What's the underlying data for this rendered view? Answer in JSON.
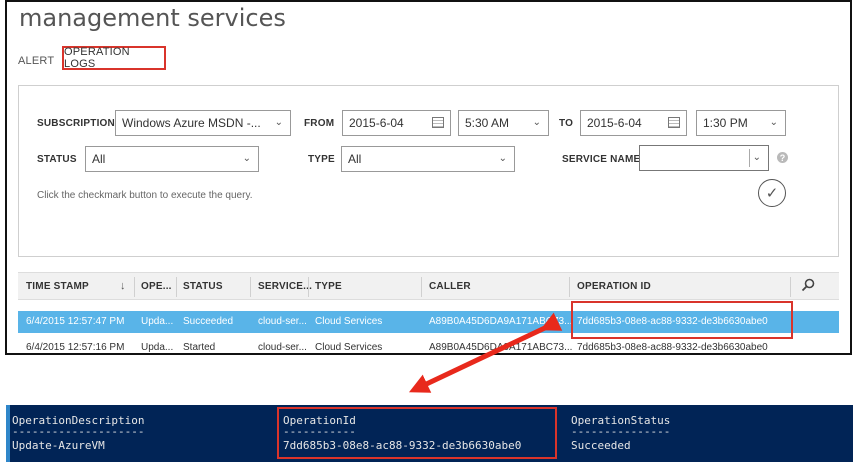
{
  "page": {
    "title": "management services"
  },
  "tabs": [
    {
      "label": "ALERT"
    },
    {
      "label": "OPERATION LOGS"
    }
  ],
  "filters": {
    "subscription": {
      "label": "SUBSCRIPTION",
      "value": "Windows Azure MSDN -..."
    },
    "from": {
      "label": "FROM",
      "date": "2015-6-04",
      "time": "5:30 AM"
    },
    "to": {
      "label": "TO",
      "date": "2015-6-04",
      "time": "1:30 PM"
    },
    "status": {
      "label": "STATUS",
      "value": "All"
    },
    "type": {
      "label": "TYPE",
      "value": "All"
    },
    "service_name": {
      "label": "SERVICE NAME",
      "value": ""
    },
    "hint": "Click the checkmark button to execute the query.",
    "help_glyph": "?",
    "execute_glyph": "✓"
  },
  "grid": {
    "columns": [
      "TIME STAMP",
      "OPE...",
      "STATUS",
      "SERVICE...",
      "TYPE",
      "CALLER",
      "OPERATION ID"
    ],
    "rows": [
      [
        "6/4/2015 12:57:47 PM",
        "Upda...",
        "Succeeded",
        "cloud-ser...",
        "Cloud Services",
        "A89B0A45D6DA9A171ABC73...",
        "7dd685b3-08e8-ac88-9332-de3b6630abe0"
      ],
      [
        "6/4/2015 12:57:16 PM",
        "Upda...",
        "Started",
        "cloud-ser...",
        "Cloud Services",
        "A89B0A45D6DA9A171ABC73...",
        "7dd685b3-08e8-ac88-9332-de3b6630abe0"
      ]
    ],
    "selected_row": 0
  },
  "console": {
    "headers": [
      "OperationDescription",
      "OperationId",
      "OperationStatus"
    ],
    "underlines": [
      "--------------------",
      "-----------",
      "---------------"
    ],
    "values": [
      "Update-AzureVM",
      "7dd685b3-08e8-ac88-9332-de3b6630abe0",
      "Succeeded"
    ]
  },
  "colors": {
    "highlight_red": "#d9342b",
    "selected_row": "#59b4e8",
    "console_bg": "#012456"
  }
}
